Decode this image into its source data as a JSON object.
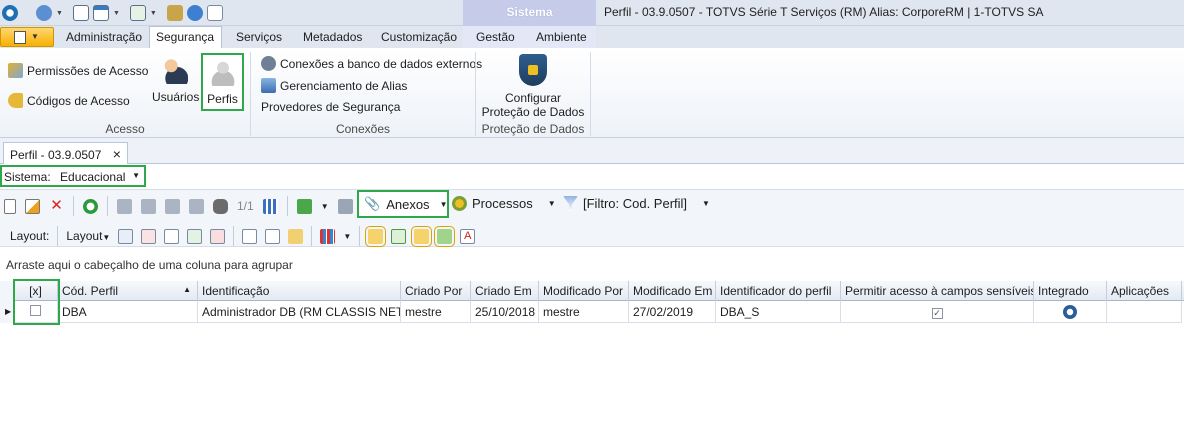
{
  "title_bar": {
    "context_group": "Sistema",
    "app_title": "Perfil - 03.9.0507 - TOTVS Série T Serviços (RM) Alias: CorporeRM | 1-TOTVS SA"
  },
  "ribbon_tabs": [
    "Administração",
    "Segurança",
    "Serviços",
    "Metadados",
    "Customização",
    "Gestão",
    "Ambiente"
  ],
  "ribbon": {
    "acesso": {
      "permissoes": "Permissões de Acesso",
      "codigos": "Códigos de Acesso",
      "usuarios": "Usuários",
      "perfis": "Perfis",
      "label": "Acesso"
    },
    "conexoes": {
      "externos": "Conexões a banco de dados externos",
      "alias": "Gerenciamento de Alias",
      "provedores": "Provedores de Segurança",
      "label": "Conexões"
    },
    "protecao": {
      "configurar_line1": "Configurar",
      "configurar_line2": "Proteção de Dados",
      "label": "Proteção de Dados"
    }
  },
  "document_tab": {
    "label": "Perfil - 03.9.0507",
    "close": "×"
  },
  "sistema": {
    "label": "Sistema:",
    "value": "Educacional"
  },
  "toolbar1": {
    "page_counter": "1/1",
    "anexos": "Anexos",
    "processos": "Processos",
    "filtro": "[Filtro: Cod. Perfil]"
  },
  "toolbar2": {
    "layout_label": "Layout:",
    "layout_menu": "Layout"
  },
  "group_hint": "Arraste aqui o cabeçalho de uma coluna para agrupar",
  "grid": {
    "columns": [
      "[x]",
      "Cód. Perfil",
      "Identificação",
      "Criado Por",
      "Criado Em",
      "Modificado Por",
      "Modificado Em",
      "Identificador do perfil",
      "Permitir acesso à campos sensíveis",
      "Integrado",
      "Aplicações"
    ],
    "rows": [
      {
        "cod": "DBA",
        "ident": "Administrador DB (RM CLASSIS NET)",
        "criado_por": "mestre",
        "criado_em": "25/10/2018",
        "mod_por": "mestre",
        "mod_em": "27/02/2019",
        "identificador": "DBA_S",
        "sensiveis": true,
        "integrado": "globe",
        "aplicacoes": ""
      }
    ]
  },
  "colors": {
    "highlight": "#2ea84a",
    "accent": "#f7b100"
  }
}
